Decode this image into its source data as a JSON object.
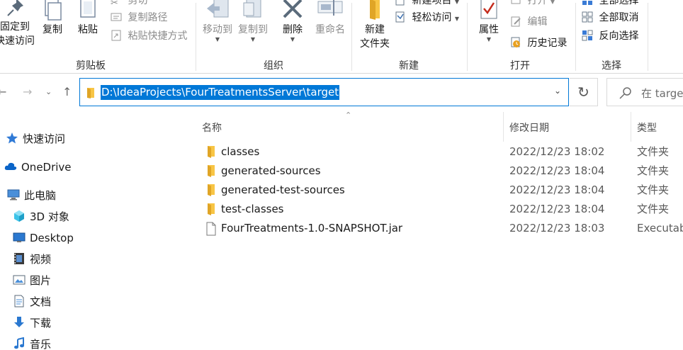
{
  "ribbon": {
    "clipboard": {
      "group_label": "剪贴板",
      "pin_label_line1": "固定到",
      "pin_label_line2": "快速访问",
      "copy_label": "复制",
      "paste_label": "粘贴",
      "cut_label": "剪切",
      "copy_path_label": "复制路径",
      "paste_shortcut_label": "粘贴快捷方式"
    },
    "organize": {
      "group_label": "组织",
      "move_to_label": "移动到",
      "copy_to_label": "复制到",
      "delete_label": "删除",
      "rename_label": "重命名"
    },
    "new": {
      "group_label": "新建",
      "new_folder_line1": "新建",
      "new_folder_line2": "文件夹",
      "new_item_label": "新建项目",
      "easy_access_label": "轻松访问"
    },
    "open": {
      "group_label": "打开",
      "properties_label": "属性",
      "open_label": "打开",
      "edit_label": "编辑",
      "history_label": "历史记录"
    },
    "select": {
      "group_label": "选择",
      "select_all_label": "全部选择",
      "select_none_label": "全部取消",
      "invert_selection_label": "反向选择"
    }
  },
  "address_bar": {
    "path": "D:\\IdeaProjects\\FourTreatmentsServer\\target",
    "search_placeholder": "在 target"
  },
  "nav_pane": {
    "items": [
      {
        "label": "快速访问",
        "icon": "star-icon"
      },
      {
        "label": "OneDrive",
        "icon": "cloud-icon"
      },
      {
        "label": "此电脑",
        "icon": "computer-icon"
      },
      {
        "label": "3D 对象",
        "icon": "cube-icon"
      },
      {
        "label": "Desktop",
        "icon": "desktop-icon"
      },
      {
        "label": "视频",
        "icon": "video-icon"
      },
      {
        "label": "图片",
        "icon": "pictures-icon"
      },
      {
        "label": "文档",
        "icon": "document-icon"
      },
      {
        "label": "下载",
        "icon": "download-icon"
      },
      {
        "label": "音乐",
        "icon": "music-icon"
      }
    ]
  },
  "file_list": {
    "columns": {
      "name": "名称",
      "date_modified": "修改日期",
      "type": "类型"
    },
    "rows": [
      {
        "name": "classes",
        "date": "2022/12/23 18:02",
        "type": "文件夹",
        "kind": "folder"
      },
      {
        "name": "generated-sources",
        "date": "2022/12/23 18:04",
        "type": "文件夹",
        "kind": "folder"
      },
      {
        "name": "generated-test-sources",
        "date": "2022/12/23 18:04",
        "type": "文件夹",
        "kind": "folder"
      },
      {
        "name": "test-classes",
        "date": "2022/12/23 18:04",
        "type": "文件夹",
        "kind": "folder"
      },
      {
        "name": "FourTreatments-1.0-SNAPSHOT.jar",
        "date": "2022/12/23 18:03",
        "type": "Executab",
        "kind": "file"
      }
    ]
  },
  "colors": {
    "accent": "#0078d7",
    "folder": "#f8c545",
    "folder_dark": "#e0a526",
    "delete_red": "#c42b1c"
  }
}
